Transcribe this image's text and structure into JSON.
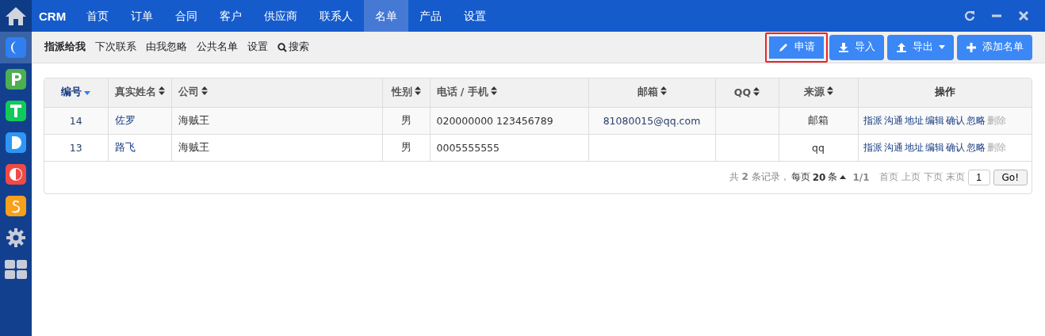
{
  "sidebar": {
    "apps": [
      {
        "kind": "c",
        "color": "#2f7ff0",
        "selected": true
      },
      {
        "kind": "p",
        "color": "#4caf50",
        "selected": false
      },
      {
        "kind": "t",
        "color": "#12c95a",
        "selected": false
      },
      {
        "kind": "d",
        "color": "#2e96f5",
        "selected": false
      },
      {
        "kind": "half",
        "color": "#ef4a45",
        "selected": false
      },
      {
        "kind": "s",
        "color": "#f7a01c",
        "selected": false
      },
      {
        "kind": "gear",
        "color": "#c7ccd8",
        "selected": false
      },
      {
        "kind": "grid",
        "color": "#c7ccd8",
        "selected": false
      }
    ]
  },
  "topbar": {
    "brand": "CRM",
    "menu": [
      {
        "label": "首页",
        "selected": false
      },
      {
        "label": "订单",
        "selected": false
      },
      {
        "label": "合同",
        "selected": false
      },
      {
        "label": "客户",
        "selected": false
      },
      {
        "label": "供应商",
        "selected": false
      },
      {
        "label": "联系人",
        "selected": false
      },
      {
        "label": "名单",
        "selected": true
      },
      {
        "label": "产品",
        "selected": false
      },
      {
        "label": "设置",
        "selected": false
      }
    ]
  },
  "subnav": {
    "items": [
      {
        "label": "指派给我",
        "selected": true
      },
      {
        "label": "下次联系",
        "selected": false
      },
      {
        "label": "由我忽略",
        "selected": false
      },
      {
        "label": "公共名单",
        "selected": false
      },
      {
        "label": "设置",
        "selected": false
      }
    ],
    "search": "搜索"
  },
  "actions": [
    {
      "label": "申请",
      "kind": "edit",
      "highlighted": true
    },
    {
      "label": "导入",
      "kind": "import",
      "highlighted": false
    },
    {
      "label": "导出",
      "kind": "export",
      "highlighted": false
    },
    {
      "label": "添加名单",
      "kind": "add",
      "highlighted": false
    }
  ],
  "table": {
    "columns": [
      {
        "label": "编号",
        "sorted": true
      },
      {
        "label": "真实姓名",
        "sorted": false
      },
      {
        "label": "公司",
        "sorted": false
      },
      {
        "label": "性别",
        "sorted": false
      },
      {
        "label": "电话 / 手机",
        "sorted": false
      },
      {
        "label": "邮箱",
        "sorted": false
      },
      {
        "label": "QQ",
        "sorted": false
      },
      {
        "label": "来源",
        "sorted": false
      },
      {
        "label": "操作",
        "sorted": false
      }
    ],
    "rows": [
      {
        "cells": [
          "14",
          "佐罗",
          "海贼王",
          "男",
          "020000000 123456789",
          "81080015@qq.com",
          "",
          "邮箱"
        ],
        "actions": [
          {
            "label": "指派",
            "disabled": false
          },
          {
            "label": "沟通",
            "disabled": false
          },
          {
            "label": "地址",
            "disabled": false
          },
          {
            "label": "编辑",
            "disabled": false
          },
          {
            "label": "确认",
            "disabled": false
          },
          {
            "label": "忽略",
            "disabled": false
          },
          {
            "label": "删除",
            "disabled": true
          }
        ]
      },
      {
        "cells": [
          "13",
          "路飞",
          "海贼王",
          "男",
          "0005555555",
          "",
          "",
          "qq"
        ],
        "actions": [
          {
            "label": "指派",
            "disabled": false
          },
          {
            "label": "沟通",
            "disabled": false
          },
          {
            "label": "地址",
            "disabled": false
          },
          {
            "label": "编辑",
            "disabled": false
          },
          {
            "label": "确认",
            "disabled": false
          },
          {
            "label": "忽略",
            "disabled": false
          },
          {
            "label": "删除",
            "disabled": true
          }
        ]
      }
    ]
  },
  "pager": {
    "summary": "共 **2** 条记录，",
    "per_page": "每页 **20** 条",
    "pages": "1/1",
    "links": [
      {
        "label": "首页",
        "disabled": true
      },
      {
        "label": "上页",
        "disabled": true
      },
      {
        "label": "下页",
        "disabled": true
      },
      {
        "label": "末页",
        "disabled": true
      }
    ],
    "page_value": "1",
    "go": "Go!"
  }
}
